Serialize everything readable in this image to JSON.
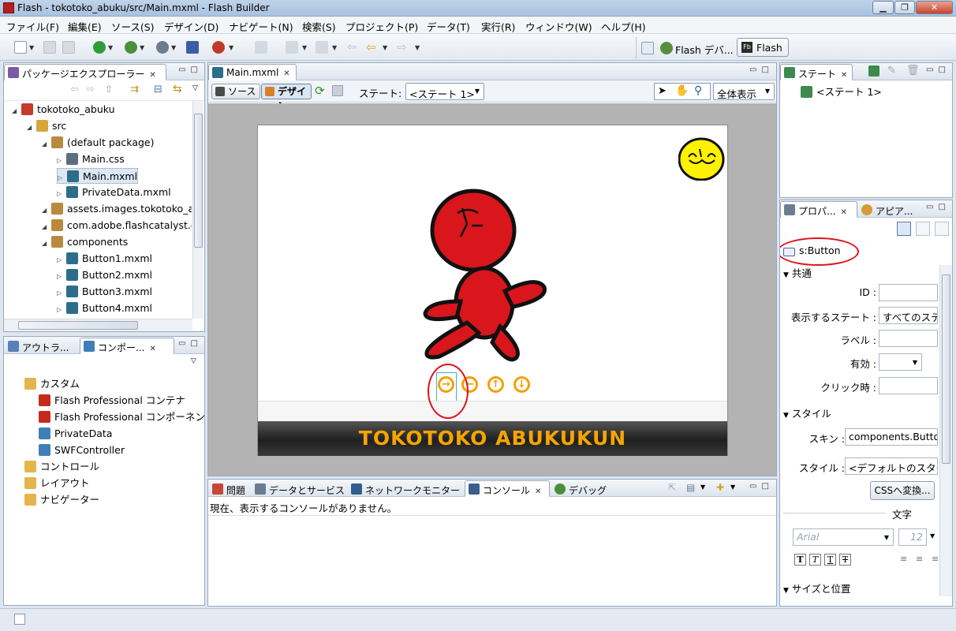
{
  "window": {
    "title": "Flash - tokotoko_abuku/src/Main.mxml - Flash Builder"
  },
  "menu": [
    "ファイル(F)",
    "編集(E)",
    "ソース(S)",
    "デザイン(D)",
    "ナビゲート(N)",
    "検索(S)",
    "プロジェクト(P)",
    "データ(T)",
    "実行(R)",
    "ウィンドウ(W)",
    "ヘルプ(H)"
  ],
  "perspectives": {
    "debug": "Flash デバ...",
    "flash": "Flash"
  },
  "package_explorer": {
    "tab": "パッケージエクスプローラー",
    "tree": [
      {
        "label": "tokotoko_abuku",
        "level": 0,
        "icon": "project-icon"
      },
      {
        "label": "src",
        "level": 1,
        "icon": "src-folder-icon"
      },
      {
        "label": "(default package)",
        "level": 2,
        "icon": "package-icon"
      },
      {
        "label": "Main.css",
        "level": 3,
        "icon": "css-file-icon"
      },
      {
        "label": "Main.mxml",
        "level": 3,
        "icon": "mxml-file-icon",
        "selected": true
      },
      {
        "label": "PrivateData.mxml",
        "level": 3,
        "icon": "mxml-file-icon"
      },
      {
        "label": "assets.images.tokotoko_a",
        "level": 2,
        "icon": "package-icon"
      },
      {
        "label": "com.adobe.flashcatalyst.c",
        "level": 2,
        "icon": "package-icon"
      },
      {
        "label": "components",
        "level": 2,
        "icon": "package-icon"
      },
      {
        "label": "Button1.mxml",
        "level": 3,
        "icon": "mxml-file-icon"
      },
      {
        "label": "Button2.mxml",
        "level": 3,
        "icon": "mxml-file-icon"
      },
      {
        "label": "Button3.mxml",
        "level": 3,
        "icon": "mxml-file-icon"
      },
      {
        "label": "Button4.mxml",
        "level": 3,
        "icon": "mxml-file-icon"
      }
    ]
  },
  "components_panel": {
    "tabs": [
      "アウトラ...",
      "コンポー..."
    ],
    "tree": [
      {
        "label": "カスタム",
        "level": 0,
        "icon": "folder-icon"
      },
      {
        "label": "Flash Professional コンテナ",
        "level": 1,
        "icon": "flash-icon"
      },
      {
        "label": "Flash Professional コンポーネン",
        "level": 1,
        "icon": "flash-icon"
      },
      {
        "label": "PrivateData",
        "level": 1,
        "icon": "component-icon"
      },
      {
        "label": "SWFController",
        "level": 1,
        "icon": "component-icon"
      },
      {
        "label": "コントロール",
        "level": 0,
        "icon": "folder-icon"
      },
      {
        "label": "レイアウト",
        "level": 0,
        "icon": "folder-icon"
      },
      {
        "label": "ナビゲーター",
        "level": 0,
        "icon": "folder-icon"
      }
    ]
  },
  "editor": {
    "tab": "Main.mxml",
    "source_btn": "ソース",
    "design_btn": "デザイン",
    "state_label": "ステート:",
    "state_value": "<ステート 1>",
    "zoom_value": "全体表示",
    "stage_title": "TOKOTOKO ABUKUKUN"
  },
  "bottom_panel": {
    "tabs": [
      "問題",
      "データとサービス",
      "ネットワークモニター",
      "コンソール",
      "デバッグ"
    ],
    "message": "現在、表示するコンソールがありません。"
  },
  "states_panel": {
    "tab": "ステート",
    "item": "<ステート 1>"
  },
  "properties_panel": {
    "tabs": [
      "プロパ...",
      "アピア..."
    ],
    "component": "s:Button",
    "sections": {
      "common": "共通",
      "style": "スタイル",
      "text": "文字",
      "size": "サイズと位置"
    },
    "fields": {
      "id_label": "ID :",
      "id_value": "",
      "states_label": "表示するステート :",
      "states_value": "すべてのステ",
      "label_label": "ラベル :",
      "label_value": "",
      "enabled_label": "有効 :",
      "enabled_value": "",
      "click_label": "クリック時 :",
      "click_value": "",
      "skin_label": "スキン :",
      "skin_value": "components.Button",
      "style_label": "スタイル :",
      "style_value": "<デフォルトのスタイ",
      "css_button": "CSSへ変換...",
      "font_value": "Arial",
      "size_value": "12"
    }
  }
}
